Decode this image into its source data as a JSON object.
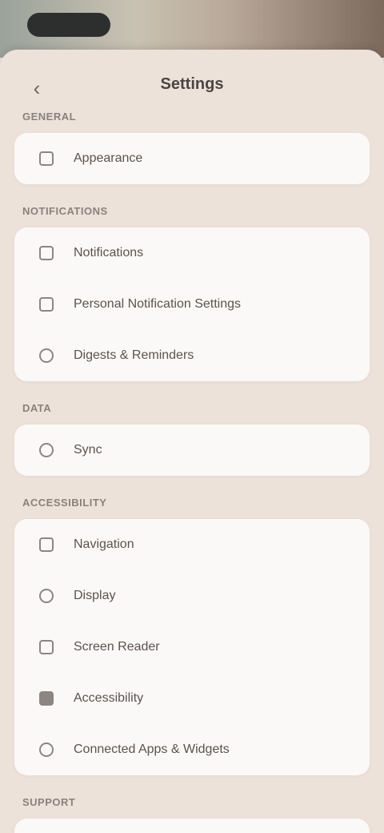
{
  "nav": {
    "title": "Settings",
    "back_icon": "chevron-left-icon"
  },
  "sections": [
    {
      "header": "General",
      "items": [
        {
          "label": "Appearance",
          "icon": "square-icon"
        }
      ]
    },
    {
      "header": "Notifications",
      "items": [
        {
          "label": "Notifications",
          "icon": "bell-icon"
        },
        {
          "label": "Personal Notification Settings",
          "icon": "square-icon"
        },
        {
          "label": "Digests & Reminders",
          "icon": "circle-icon"
        }
      ]
    },
    {
      "header": "Data",
      "items": [
        {
          "label": "Sync",
          "icon": "sync-icon"
        }
      ]
    },
    {
      "header": "Accessibility",
      "items": [
        {
          "label": "Navigation",
          "icon": "square-icon"
        },
        {
          "label": "Display",
          "icon": "circle-icon"
        },
        {
          "label": "Screen Reader",
          "icon": "square-icon"
        },
        {
          "label": "Accessibility",
          "icon": "filled-square-icon"
        },
        {
          "label": "Connected Apps & Widgets",
          "icon": "circle-icon"
        }
      ]
    },
    {
      "header": "Support",
      "items": []
    }
  ]
}
